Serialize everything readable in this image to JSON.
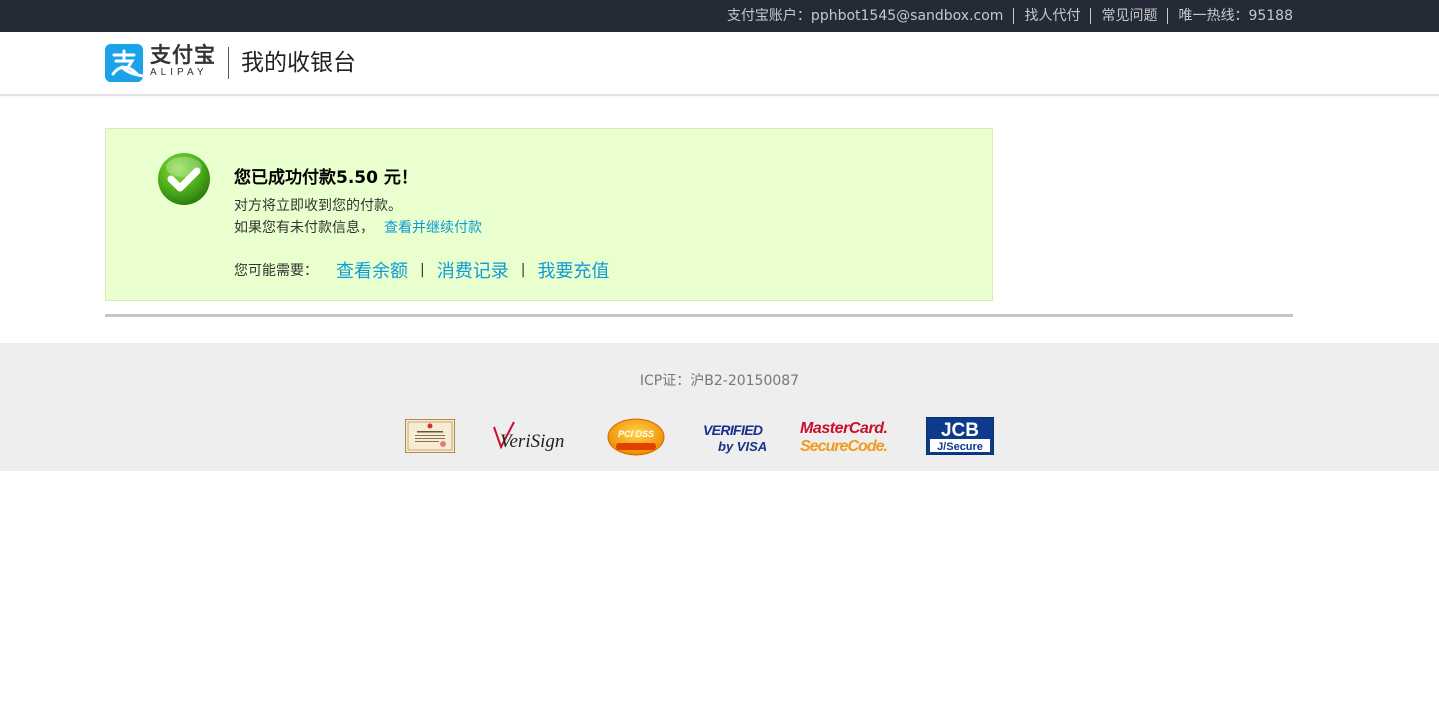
{
  "topbar": {
    "links": [
      "支付宝账户：pphbot1545@sandbox.com",
      "找人代付",
      "常见问题",
      "唯一热线：95188"
    ]
  },
  "header": {
    "logo_cn": "支付宝",
    "logo_en": "ALIPAY",
    "title": "我的收银台"
  },
  "success": {
    "title": "您已成功付款5.50 元！",
    "line1": "对方将立即收到您的付款。",
    "line2": "如果您有未付款信息，",
    "line2_link": "查看并继续付款",
    "maybe_label": "您可能需要：",
    "maybe_links": [
      "查看余额",
      "消费记录",
      "我要充值"
    ],
    "separator": "|"
  },
  "footer": {
    "icp": "ICP证：沪B2-20150087",
    "badges": [
      {
        "name": "certificate-badge",
        "text": ""
      },
      {
        "name": "verisign-badge",
        "text": "VeriSign"
      },
      {
        "name": "pci-dss-badge",
        "text": "PCI DSS"
      },
      {
        "name": "verified-by-visa-badge",
        "text": "VERIFIED by VISA"
      },
      {
        "name": "mastercard-securecode-badge",
        "text": "MasterCard. SecureCode."
      },
      {
        "name": "jcb-jsecure-badge",
        "text": "JCB J/Secure"
      }
    ]
  },
  "colors": {
    "topbar_bg": "#252a37",
    "accent_blue": "#0f9bd7",
    "success_bg": "#e9ffcd",
    "logo_blue": "#1aa3e8",
    "check_green": "#4caf1a"
  }
}
